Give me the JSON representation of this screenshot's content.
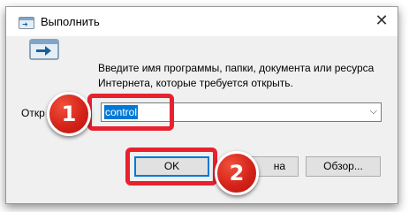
{
  "window": {
    "title": "Выполнить",
    "close_glyph": "✕"
  },
  "description": {
    "line1": "Введите имя программы, папки, документа или ресурса",
    "line2": "Интернета, которые требуется открыть."
  },
  "open_field": {
    "label": "Откр",
    "value": "control",
    "dropdown_glyph": "⌵"
  },
  "buttons": {
    "ok": "OK",
    "cancel_visible": "на",
    "browse": "Обзор..."
  },
  "annotations": {
    "step1": "1",
    "step2": "2",
    "highlight_color": "#e8212f",
    "accent": "#0078d7"
  }
}
